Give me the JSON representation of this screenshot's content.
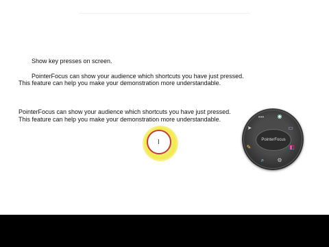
{
  "document": {
    "line1": "Show key presses on screen.",
    "line2": "PointerFocus can show your audience which shortcuts you have just pressed.",
    "line3": "This feature can help you make your demonstration more understandable.",
    "line4": "PointerFocus can show your audience which shortcuts you have just pressed.",
    "line5": "This feature can help you make your demonstration more understandable."
  },
  "cursor": {
    "glyph": "I"
  },
  "radial_menu": {
    "center_label": "PointerFocus",
    "items": [
      {
        "icon": "ellipsis-icon",
        "glyph": "•••"
      },
      {
        "icon": "highlight-icon",
        "glyph": "◉"
      },
      {
        "icon": "monitor-icon",
        "glyph": "▭"
      },
      {
        "icon": "eraser-icon",
        "glyph": "◧"
      },
      {
        "icon": "settings-icon",
        "glyph": "⚙"
      },
      {
        "icon": "magnifier-icon",
        "glyph": "⌕"
      },
      {
        "icon": "pen-icon",
        "glyph": "✎"
      },
      {
        "icon": "cursor-icon",
        "glyph": "➤"
      }
    ]
  }
}
